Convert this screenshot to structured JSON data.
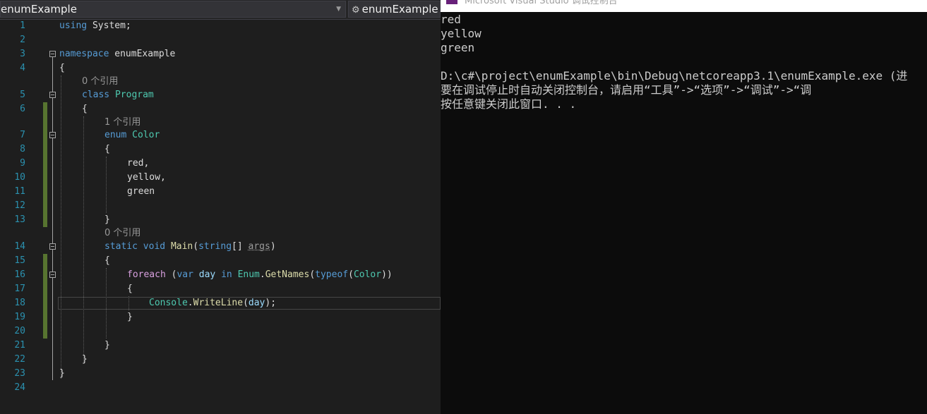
{
  "editor": {
    "nav_left": "enumExample",
    "nav_right": "enumExample",
    "line_numbers": [
      "1",
      "2",
      "3",
      "4",
      "5",
      "6",
      "7",
      "8",
      "9",
      "10",
      "11",
      "12",
      "13",
      "14",
      "15",
      "16",
      "17",
      "18",
      "19",
      "20",
      "21",
      "22",
      "23",
      "24"
    ],
    "references": {
      "program": "0 个引用",
      "color": "1 个引用",
      "main": "0 个引用"
    },
    "code": {
      "l1_kw": "using",
      "l1_rest": " System;",
      "l3_kw": "namespace",
      "l3_rest": " enumExample",
      "l4": "{",
      "l5_kw": "class",
      "l5_type": "Program",
      "l6": "{",
      "l7_kw": "enum",
      "l7_type": "Color",
      "l8": "{",
      "l9": "red,",
      "l10": "yellow,",
      "l11": "green",
      "l13": "}",
      "l14_kw1": "static",
      "l14_kw2": "void",
      "l14_fn": "Main",
      "l14_p1": "(",
      "l14_kw3": "string",
      "l14_p2": "[] ",
      "l14_args": "args",
      "l14_p3": ")",
      "l15": "{",
      "l16_ctl": "foreach",
      "l16_p1": " (",
      "l16_kw1": "var",
      "l16_var": "day",
      "l16_kw2": "in",
      "l16_type": "Enum",
      "l16_dot": ".",
      "l16_fn": "GetNames",
      "l16_p2": "(",
      "l16_kw3": "typeof",
      "l16_p3": "(",
      "l16_type2": "Color",
      "l16_p4": "))",
      "l17": "{",
      "l18_type": "Console",
      "l18_dot": ".",
      "l18_fn": "WriteLine",
      "l18_p1": "(",
      "l18_var": "day",
      "l18_p2": ");",
      "l19": "}",
      "l21": "}",
      "l22": "}",
      "l23": "}"
    }
  },
  "console": {
    "title": "Microsoft Visual Studio 调试控制台",
    "lines": [
      "red",
      "yellow",
      "green",
      "",
      "D:\\c#\\project\\enumExample\\bin\\Debug\\netcoreapp3.1\\enumExample.exe (进",
      "要在调试停止时自动关闭控制台，请启用“工具”->“选项”->“调试”->“调",
      "按任意键关闭此窗口. . ."
    ]
  },
  "colors": {
    "keyword": "#569cd6",
    "type": "#4ec9b0",
    "method": "#dcdcaa",
    "variable": "#9cdcfe",
    "control": "#d8a0df",
    "line_number": "#2b91af",
    "change_margin": "#577430"
  }
}
